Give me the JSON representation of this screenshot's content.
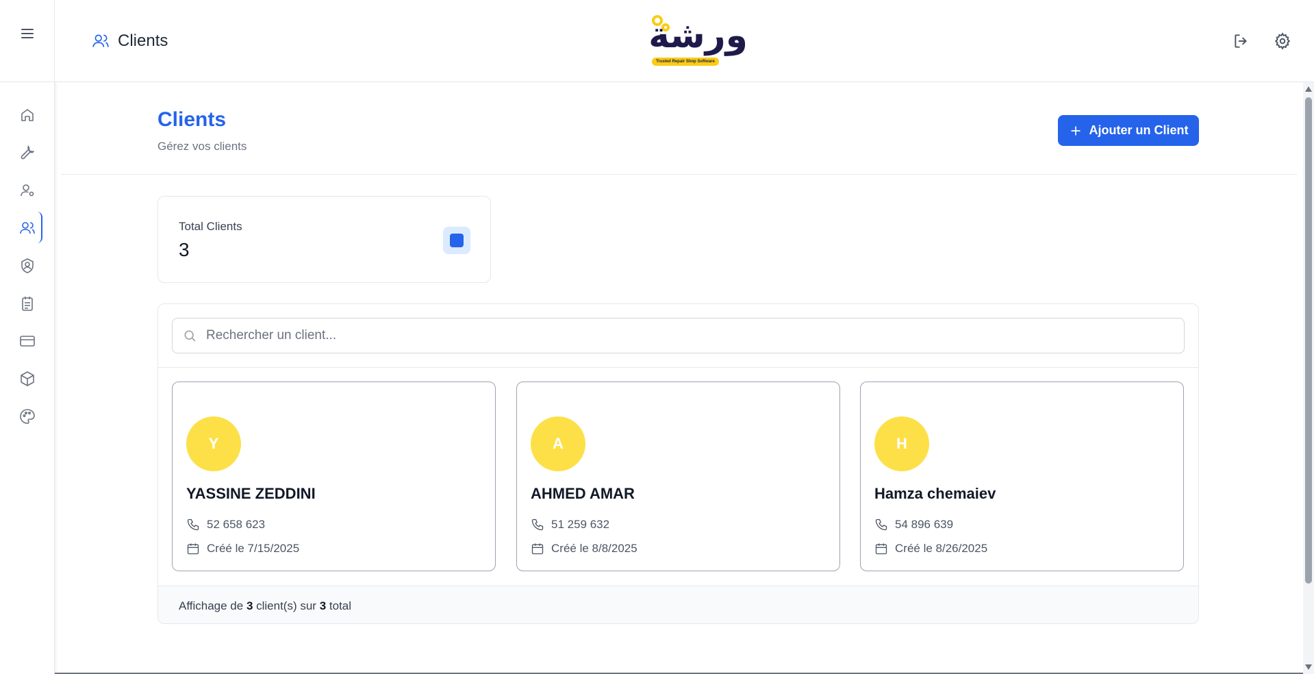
{
  "header": {
    "title": "Clients",
    "logo_text": "ورشة",
    "logo_tagline": "Trusted Repair Shop Software"
  },
  "sidebar": {
    "items": [
      {
        "icon": "home-icon"
      },
      {
        "icon": "wrench-icon"
      },
      {
        "icon": "user-settings-icon"
      },
      {
        "icon": "users-icon",
        "active": true
      },
      {
        "icon": "shield-user-icon"
      },
      {
        "icon": "clipboard-icon"
      },
      {
        "icon": "credit-card-icon"
      },
      {
        "icon": "package-icon"
      },
      {
        "icon": "palette-icon"
      }
    ]
  },
  "page": {
    "title": "Clients",
    "subtitle": "Gérez vos clients",
    "add_button_label": "Ajouter un Client"
  },
  "stats": {
    "label": "Total Clients",
    "value": "3"
  },
  "search": {
    "placeholder": "Rechercher un client...",
    "value": ""
  },
  "clients": [
    {
      "initial": "Y",
      "name": "YASSINE ZEDDINI",
      "phone": "52 658 623",
      "created": "Créé le 7/15/2025"
    },
    {
      "initial": "A",
      "name": "AHMED AMAR",
      "phone": "51 259 632",
      "created": "Créé le 8/8/2025"
    },
    {
      "initial": "H",
      "name": "Hamza chemaiev",
      "phone": "54 896 639",
      "created": "Créé le 8/26/2025"
    }
  ],
  "footer": {
    "prefix": "Affichage de",
    "shown": "3",
    "middle": "client(s) sur",
    "total": "3",
    "suffix": "total"
  },
  "colors": {
    "accent": "#2563eb",
    "avatar": "#fde047"
  }
}
